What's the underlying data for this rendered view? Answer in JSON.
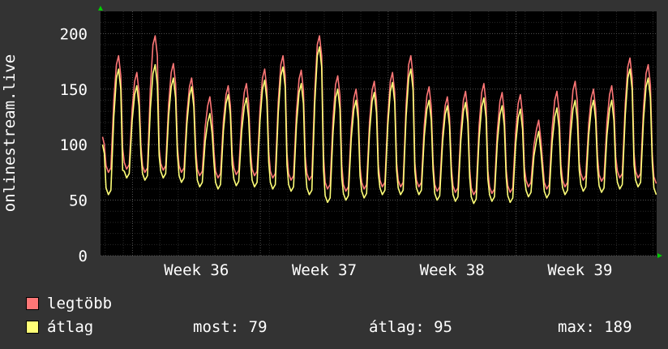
{
  "chart_data": {
    "type": "line",
    "ylabel": "onlinestream.live",
    "ylim": [
      0,
      220
    ],
    "yticks": [
      0,
      50,
      100,
      150,
      200
    ],
    "xlim": [
      35.25,
      39.6
    ],
    "xticks": [
      {
        "value": 36,
        "label": "Week 36"
      },
      {
        "value": 37,
        "label": "Week 37"
      },
      {
        "value": 38,
        "label": "Week 38"
      },
      {
        "value": 39,
        "label": "Week 39"
      }
    ],
    "grid": true,
    "x_axis_unit": "week",
    "daily_peaks": [
      {
        "day": 0,
        "max": 125,
        "avg": 118
      },
      {
        "day": 1,
        "max": 180,
        "avg": 168
      },
      {
        "day": 2,
        "max": 165,
        "avg": 153
      },
      {
        "day": 3,
        "max": 198,
        "avg": 172
      },
      {
        "day": 4,
        "max": 173,
        "avg": 160
      },
      {
        "day": 5,
        "max": 160,
        "avg": 152
      },
      {
        "day": 6,
        "max": 143,
        "avg": 128
      },
      {
        "day": 7,
        "max": 153,
        "avg": 145
      },
      {
        "day": 8,
        "max": 155,
        "avg": 142
      },
      {
        "day": 9,
        "max": 168,
        "avg": 158
      },
      {
        "day": 10,
        "max": 180,
        "avg": 170
      },
      {
        "day": 11,
        "max": 167,
        "avg": 155
      },
      {
        "day": 12,
        "max": 198,
        "avg": 188
      },
      {
        "day": 13,
        "max": 162,
        "avg": 150
      },
      {
        "day": 14,
        "max": 150,
        "avg": 140
      },
      {
        "day": 15,
        "max": 157,
        "avg": 147
      },
      {
        "day": 16,
        "max": 165,
        "avg": 156
      },
      {
        "day": 17,
        "max": 180,
        "avg": 168
      },
      {
        "day": 18,
        "max": 152,
        "avg": 140
      },
      {
        "day": 19,
        "max": 143,
        "avg": 135
      },
      {
        "day": 20,
        "max": 148,
        "avg": 138
      },
      {
        "day": 21,
        "max": 155,
        "avg": 142
      },
      {
        "day": 22,
        "max": 147,
        "avg": 135
      },
      {
        "day": 23,
        "max": 145,
        "avg": 132
      },
      {
        "day": 24,
        "max": 122,
        "avg": 112
      },
      {
        "day": 25,
        "max": 148,
        "avg": 133
      },
      {
        "day": 26,
        "max": 157,
        "avg": 140
      },
      {
        "day": 27,
        "max": 150,
        "avg": 140
      },
      {
        "day": 28,
        "max": 153,
        "avg": 140
      },
      {
        "day": 29,
        "max": 178,
        "avg": 168
      },
      {
        "day": 30,
        "max": 172,
        "avg": 160
      },
      {
        "day": 31,
        "max": 155,
        "avg": 142
      },
      {
        "day": 32,
        "max": 160,
        "avg": 148
      },
      {
        "day": 33,
        "max": 150,
        "avg": 140
      },
      {
        "day": 34,
        "max": 157,
        "avg": 148
      },
      {
        "day": 35,
        "max": 165,
        "avg": 155
      },
      {
        "day": 36,
        "max": 152,
        "avg": 142
      },
      {
        "day": 37,
        "max": 145,
        "avg": 133
      },
      {
        "day": 38,
        "max": 163,
        "avg": 152
      }
    ],
    "daily_troughs": [
      {
        "day": 0,
        "max": 78,
        "avg": 70
      },
      {
        "day": 1,
        "max": 75,
        "avg": 55
      },
      {
        "day": 2,
        "max": 78,
        "avg": 70
      },
      {
        "day": 3,
        "max": 75,
        "avg": 68
      },
      {
        "day": 4,
        "max": 77,
        "avg": 70
      },
      {
        "day": 5,
        "max": 75,
        "avg": 66
      },
      {
        "day": 6,
        "max": 72,
        "avg": 62
      },
      {
        "day": 7,
        "max": 70,
        "avg": 60
      },
      {
        "day": 8,
        "max": 73,
        "avg": 63
      },
      {
        "day": 9,
        "max": 72,
        "avg": 62
      },
      {
        "day": 10,
        "max": 70,
        "avg": 60
      },
      {
        "day": 11,
        "max": 68,
        "avg": 58
      },
      {
        "day": 12,
        "max": 68,
        "avg": 55
      },
      {
        "day": 13,
        "max": 60,
        "avg": 48
      },
      {
        "day": 14,
        "max": 58,
        "avg": 50
      },
      {
        "day": 15,
        "max": 60,
        "avg": 52
      },
      {
        "day": 16,
        "max": 62,
        "avg": 55
      },
      {
        "day": 17,
        "max": 62,
        "avg": 55
      },
      {
        "day": 18,
        "max": 62,
        "avg": 55
      },
      {
        "day": 19,
        "max": 58,
        "avg": 50
      },
      {
        "day": 20,
        "max": 57,
        "avg": 49
      },
      {
        "day": 21,
        "max": 55,
        "avg": 47
      },
      {
        "day": 22,
        "max": 56,
        "avg": 49
      },
      {
        "day": 23,
        "max": 57,
        "avg": 48
      },
      {
        "day": 24,
        "max": 62,
        "avg": 53
      },
      {
        "day": 25,
        "max": 60,
        "avg": 52
      },
      {
        "day": 26,
        "max": 62,
        "avg": 55
      },
      {
        "day": 27,
        "max": 68,
        "avg": 58
      },
      {
        "day": 28,
        "max": 67,
        "avg": 57
      },
      {
        "day": 29,
        "max": 70,
        "avg": 60
      },
      {
        "day": 30,
        "max": 70,
        "avg": 62
      },
      {
        "day": 31,
        "max": 65,
        "avg": 55
      },
      {
        "day": 32,
        "max": 62,
        "avg": 55
      },
      {
        "day": 33,
        "max": 58,
        "avg": 52
      },
      {
        "day": 34,
        "max": 62,
        "avg": 55
      },
      {
        "day": 35,
        "max": 65,
        "avg": 57
      },
      {
        "day": 36,
        "max": 70,
        "avg": 62
      },
      {
        "day": 37,
        "max": 75,
        "avg": 68
      },
      {
        "day": 38,
        "max": 85,
        "avg": 75
      }
    ],
    "series": [
      {
        "name": "legtöbb",
        "color": "#ff7777"
      },
      {
        "name": "átlag",
        "color": "#ffff77"
      }
    ]
  },
  "legend": {
    "max_label": "legtöbb",
    "avg_label": "átlag",
    "max_color": "#ff7777",
    "avg_color": "#ffff77",
    "stat_current": "most: 79",
    "stat_average": "átlag: 95",
    "stat_max": "max: 189"
  },
  "colors": {
    "background": "#333333",
    "plot_background": "#000000",
    "grid": "#444444",
    "axis_arrow": "#00cc00"
  }
}
